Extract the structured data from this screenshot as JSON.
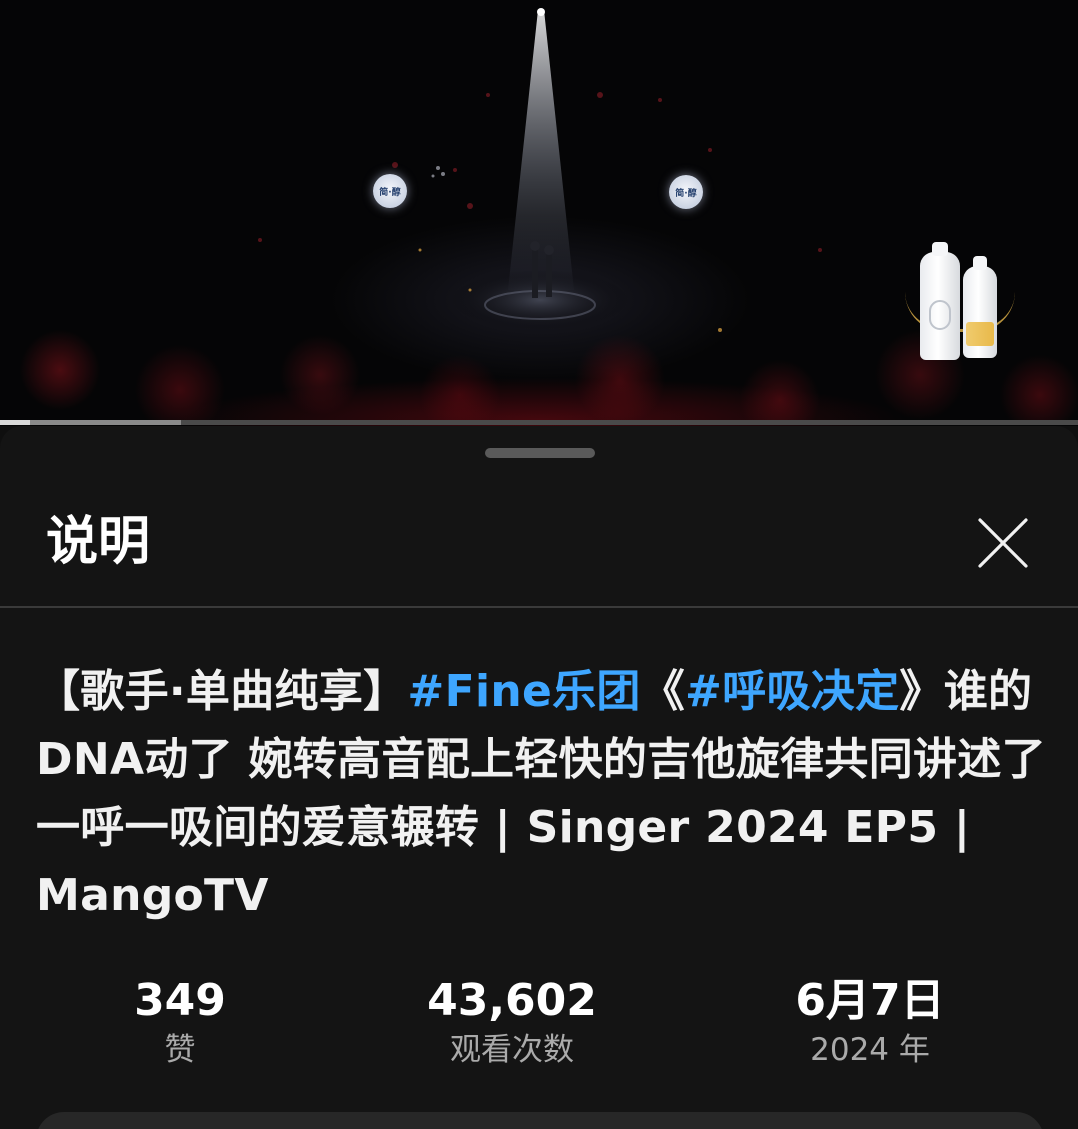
{
  "video": {
    "sponsor_disc_text": "简·醇",
    "progress": {
      "played_fraction": 0.028,
      "buffered_fraction": 0.168
    }
  },
  "sheet": {
    "title": "说明",
    "close_icon": "close-icon"
  },
  "description": {
    "title_segments": [
      {
        "text": "【歌手·单曲纯享】",
        "is_tag": false
      },
      {
        "text": "#Fine乐团",
        "is_tag": true
      },
      {
        "text": "《",
        "is_tag": false
      },
      {
        "text": "#呼吸决定",
        "is_tag": true
      },
      {
        "text": "》谁的DNA动了 婉转高音配上轻快的吉他旋律共同讲述了一呼一吸间的爱意辗转 | Singer 2024 EP5 | MangoTV",
        "is_tag": false
      }
    ]
  },
  "stats": {
    "likes": {
      "value": "349",
      "label": "赞"
    },
    "views": {
      "value": "43,602",
      "label": "观看次数"
    },
    "date": {
      "value": "6月7日",
      "label": "2024 年"
    }
  },
  "colors": {
    "background": "#0f0f0f",
    "sheet": "#141414",
    "hashtag": "#3ea6ff",
    "muted_text": "#aaaaaa"
  }
}
